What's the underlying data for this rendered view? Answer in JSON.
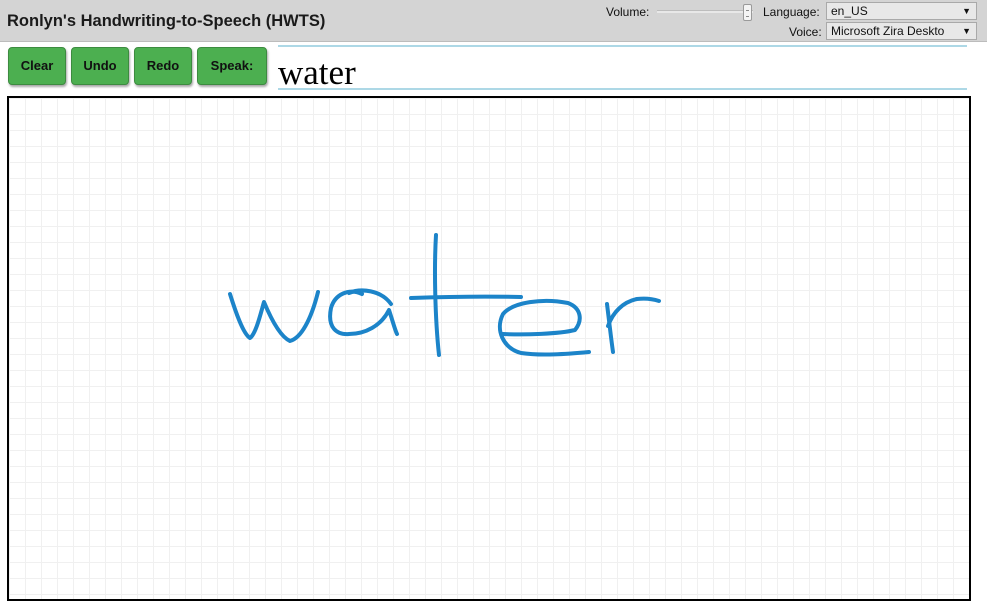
{
  "app": {
    "title": "Ronlyn's Handwriting-to-Speech (HWTS)"
  },
  "controls": {
    "volume_label": "Volume:",
    "volume_level": 0.95,
    "language_label": "Language:",
    "language_value": "en_US",
    "voice_label": "Voice:",
    "voice_value": "Microsoft Zira Deskto"
  },
  "toolbar": {
    "clear_label": "Clear",
    "undo_label": "Undo",
    "redo_label": "Redo",
    "speak_label": "Speak:"
  },
  "result": {
    "text": "water"
  },
  "canvas": {
    "ink_color": "#1c84c9",
    "grid_color": "#f0f0f0"
  },
  "colors": {
    "button_green": "#4caf50",
    "result_border": "#add8e6",
    "topbar": "#d4d4d4"
  }
}
